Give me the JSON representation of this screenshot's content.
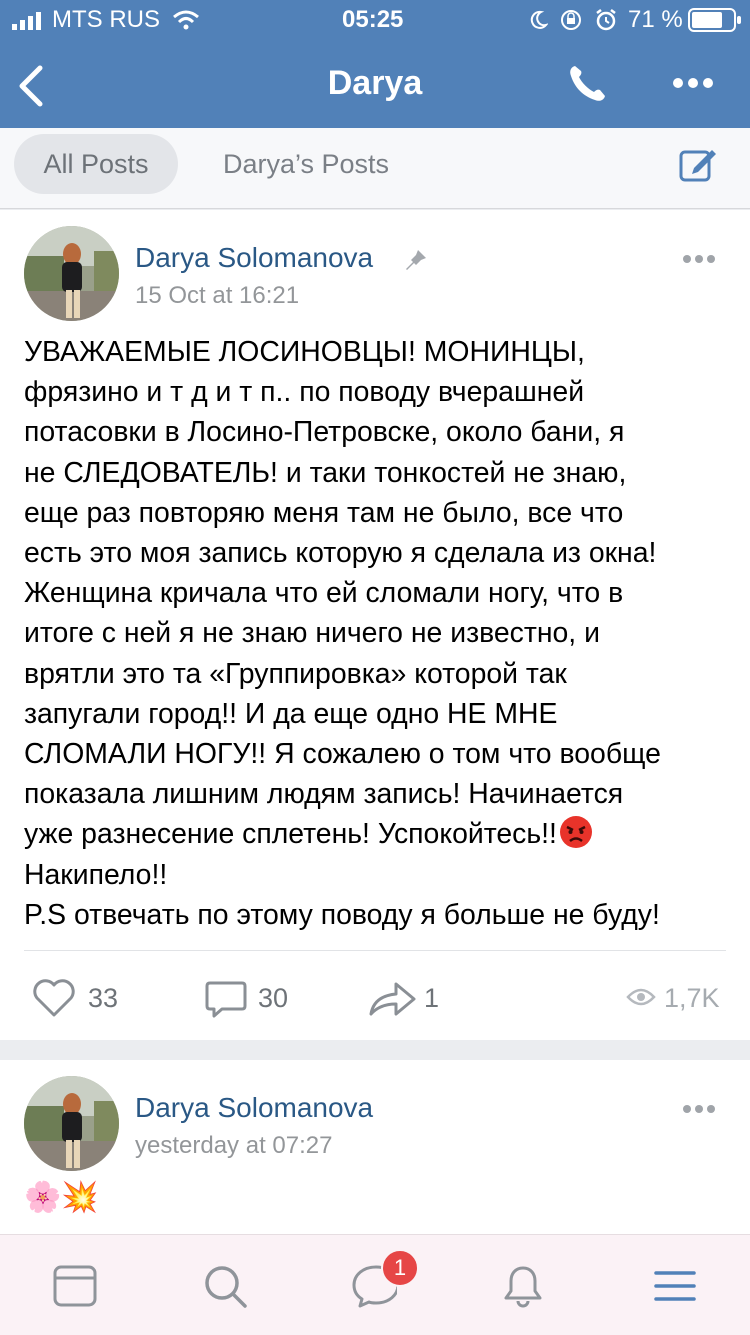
{
  "status_bar": {
    "carrier": "MTS RUS",
    "time": "05:25",
    "battery_percent": "71 %"
  },
  "nav": {
    "title": "Darya"
  },
  "tabs": [
    {
      "label": "All Posts",
      "active": true
    },
    {
      "label": "Darya’s Posts",
      "active": false
    }
  ],
  "posts": [
    {
      "author": "Darya Solomanova",
      "pinned": true,
      "timestamp": "15 Oct at 16:21",
      "text": "УВАЖАЕМЫЕ ЛОСИНОВЦЫ! МОНИНЦЫ,\nфрязино и т д и т п.. по  поводу вчерашней\nпотасовки в Лосино-Петровске, около бани, я\nне СЛЕДОВАТЕЛЬ! и таки тонкостей не знаю,\nеще раз повторяю меня там не было, все что\nесть это моя запись которую я сделала из окна!\nЖенщина кричала что ей сломали ногу, что в\nитоге с ней я не знаю ничего не известно, и\nврятли это та «Группировка» которой так\nзапугали город!!  И да еще одно НЕ МНЕ\nСЛОМАЛИ НОГУ!! Я сожалею о том что вообще\nпоказала лишним людям запись! Начинается\nуже разнесение сплетень! Успокойтесь!!",
      "text_tail": "Накипело!!\nP.S отвечать по этому поводу я больше не буду!",
      "likes": "33",
      "comments": "30",
      "shares": "1",
      "views": "1,7K"
    },
    {
      "author": "Darya Solomanova",
      "timestamp": "yesterday at 07:27",
      "text": "🌸💥"
    }
  ],
  "tabbar": {
    "messages_badge": "1"
  },
  "colors": {
    "header_blue": "#5181b8",
    "link_blue": "#2a5885",
    "badge_red": "#e64646"
  }
}
